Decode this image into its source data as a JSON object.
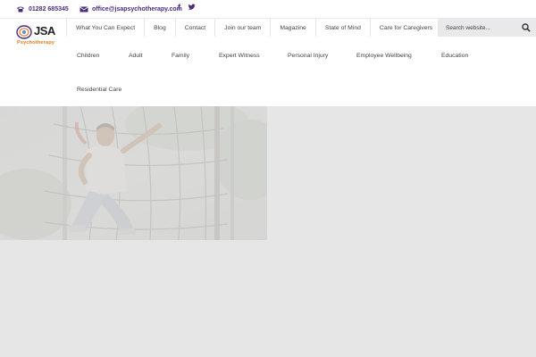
{
  "colors": {
    "brand_purple": "#4a2d7a",
    "brand_orange": "#e07a1f",
    "page_bg": "#e6e6e6",
    "header_bg": "#ffffff"
  },
  "topbar": {
    "phone_icon": "phone-icon",
    "phone": "01282 685345",
    "email_icon": "envelope-icon",
    "email": "office@jsapsychotherapy.com",
    "social": [
      {
        "icon": "facebook-icon",
        "glyph": "f"
      },
      {
        "icon": "twitter-icon",
        "glyph": "t"
      }
    ]
  },
  "logo": {
    "text": "JSA",
    "subtitle": "Psychotherapy"
  },
  "nav": {
    "top_items": [
      "What You Can Expect",
      "Blog",
      "Contact",
      "Join our team",
      "Magazine",
      "State of Mind",
      "Care for Caregivers"
    ],
    "categories": [
      "Children",
      "Adult",
      "Family",
      "Expert Witness",
      "Personal Injury",
      "Employee Wellbeing",
      "Education",
      "Residential Care"
    ]
  },
  "search": {
    "placeholder": "Search website...",
    "icon": "search-icon"
  },
  "hero": {
    "image": "child-climbing-playground-net-photo"
  }
}
